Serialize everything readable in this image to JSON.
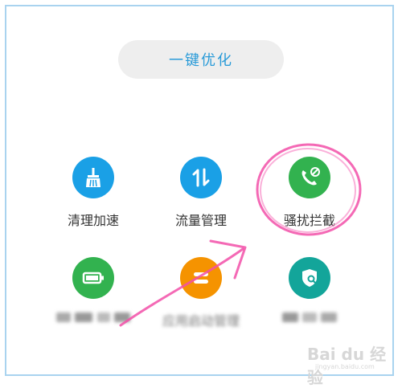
{
  "optimize_label": "一键优化",
  "tools": [
    {
      "id": "clean",
      "label": "清理加速",
      "color": "#1aa0e6",
      "icon": "broom-icon"
    },
    {
      "id": "traffic",
      "label": "流量管理",
      "color": "#1aa0e6",
      "icon": "up-down-arrows-icon"
    },
    {
      "id": "block",
      "label": "骚扰拦截",
      "color": "#32b24f",
      "icon": "phone-block-icon"
    }
  ],
  "tools_row2": [
    {
      "id": "battery",
      "label": "",
      "color": "#32b24f",
      "icon": "battery-icon"
    },
    {
      "id": "startup",
      "label": "应用启动管理",
      "color": "#f59300",
      "icon": "app-manage-icon"
    },
    {
      "id": "virus",
      "label": "",
      "color": "#13a59a",
      "icon": "shield-search-icon"
    }
  ],
  "watermark": "Bai du 经验",
  "watermark_url": "jingyan.baidu.com",
  "colors": {
    "accent": "#2a9bd8",
    "annotation": "#f24fa8",
    "frame": "#a9d3ef"
  }
}
